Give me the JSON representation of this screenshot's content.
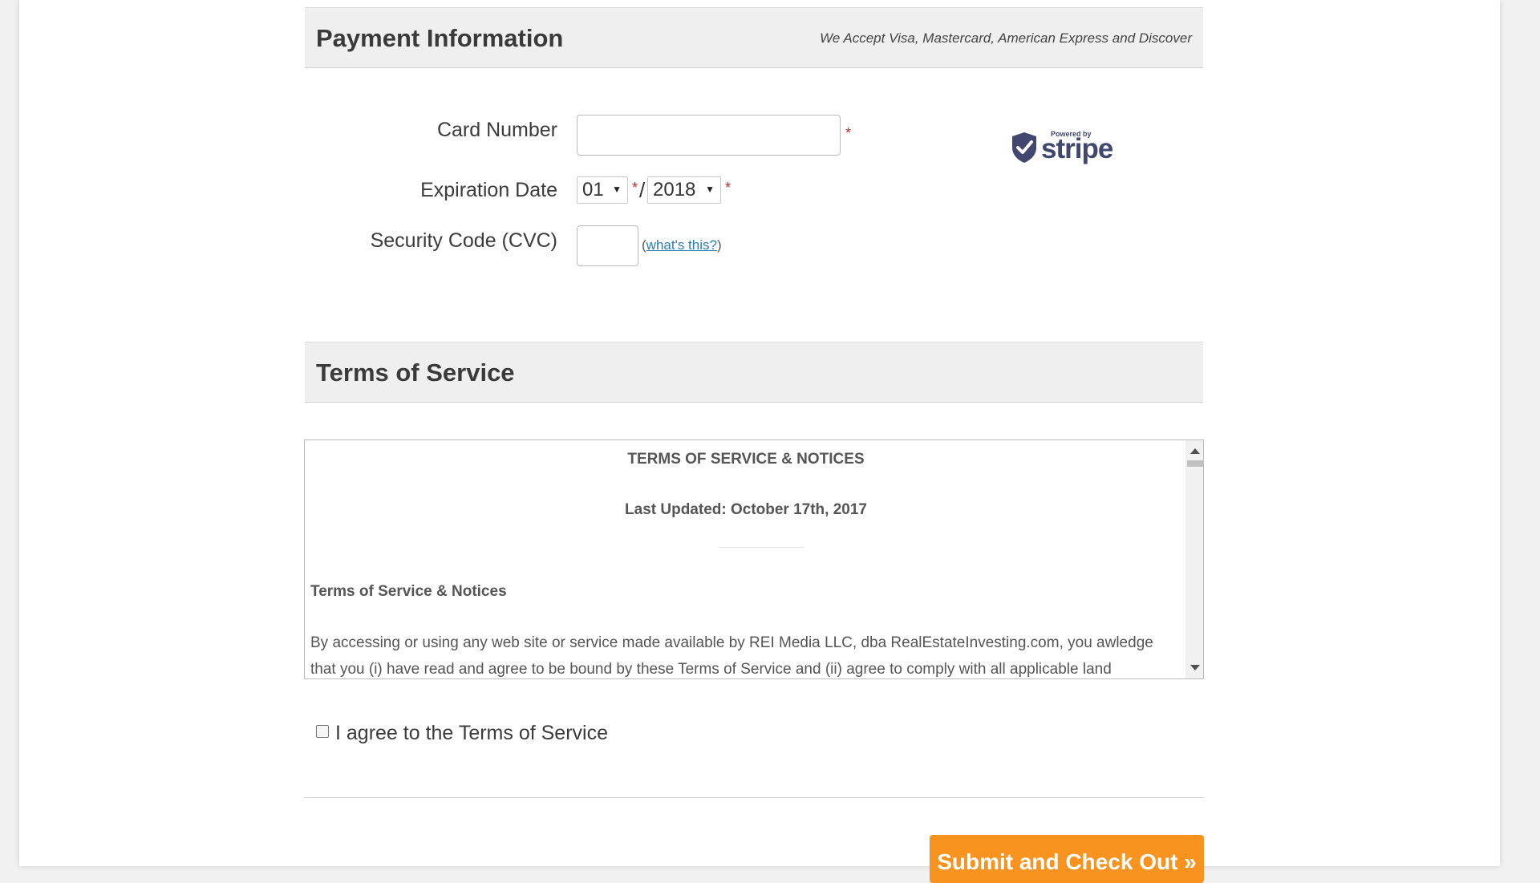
{
  "payment": {
    "title": "Payment Information",
    "accepted_cards": "We Accept Visa, Mastercard, American Express and Discover",
    "card_number_label": "Card Number",
    "card_number_value": "",
    "expiration_label": "Expiration Date",
    "exp_month": "01",
    "exp_year": "2018",
    "cvc_label": "Security Code (CVC)",
    "cvc_value": "",
    "help_open": "(",
    "help_link": "what's this?",
    "help_close": ")",
    "required_mark": "*",
    "slash": "/",
    "stripe_powered": "Powered by",
    "stripe_word": "stripe"
  },
  "terms": {
    "title": "Terms of Service",
    "heading": "TERMS OF SERVICE & NOTICES",
    "last_updated": "Last Updated: October 17th, 2017",
    "subheading": "Terms of Service & Notices",
    "paragraph": "By accessing or using any web site or service made available by REI Media LLC, dba RealEstateInvesting.com, you awledge that you (i) have read and agree to be bound by these Terms of Service and (ii) agree to comply with all applicable land",
    "agree_label": "I agree to the Terms of Service",
    "agree_checked": false
  },
  "submit": {
    "label": "Submit and Check Out »"
  },
  "colors": {
    "accent": "#f7931e",
    "required": "#c62828",
    "link": "#2a7ab8",
    "stripe": "#424770"
  },
  "icons": [
    "stripe-shield-icon",
    "dropdown-arrow-icon",
    "scroll-up-icon",
    "scroll-down-icon"
  ]
}
